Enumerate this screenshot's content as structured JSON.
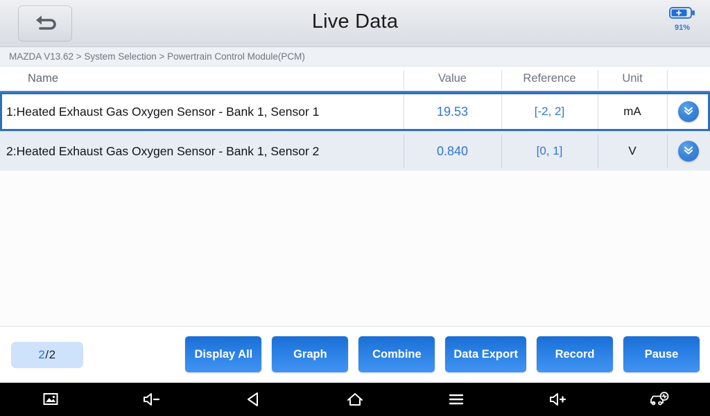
{
  "titlebar": {
    "back_icon": "back-arrow-icon",
    "title": "Live Data",
    "battery_icon": "battery-charging-icon",
    "battery_percent": "91%"
  },
  "breadcrumb": {
    "text": "MAZDA  V13.62 > System Selection  > Powertrain Control Module(PCM)"
  },
  "table": {
    "columns": [
      "Name",
      "Value",
      "Reference",
      "Unit"
    ],
    "rows": [
      {
        "name": "1:Heated Exhaust Gas Oxygen Sensor - Bank 1, Sensor 1",
        "value": "19.53",
        "reference": "[-2, 2]",
        "unit": "mA",
        "expand_icon": "double-chevron-down-icon"
      },
      {
        "name": "2:Heated Exhaust Gas Oxygen Sensor - Bank 1, Sensor 2",
        "value": "0.840",
        "reference": "[0, 1]",
        "unit": "V",
        "expand_icon": "double-chevron-down-icon"
      }
    ]
  },
  "actionbar": {
    "counter_current": "2",
    "counter_total": "/2",
    "buttons": [
      {
        "label": "Display All"
      },
      {
        "label": "Graph"
      },
      {
        "label": "Combine"
      },
      {
        "label": "Data Export"
      },
      {
        "label": "Record"
      },
      {
        "label": "Pause"
      }
    ]
  },
  "navbar": {
    "items": [
      {
        "icon": "screenshot-icon"
      },
      {
        "icon": "volume-down-icon"
      },
      {
        "icon": "back-triangle-icon"
      },
      {
        "icon": "home-icon"
      },
      {
        "icon": "menu-icon"
      },
      {
        "icon": "volume-up-icon"
      },
      {
        "icon": "vehicle-diagnostics-icon"
      }
    ]
  },
  "colors": {
    "accent_blue": "#2f76d6",
    "selected_border": "#2f6fba",
    "button_blue": "#2a80e4",
    "row_alt": "#e8ecf3"
  }
}
